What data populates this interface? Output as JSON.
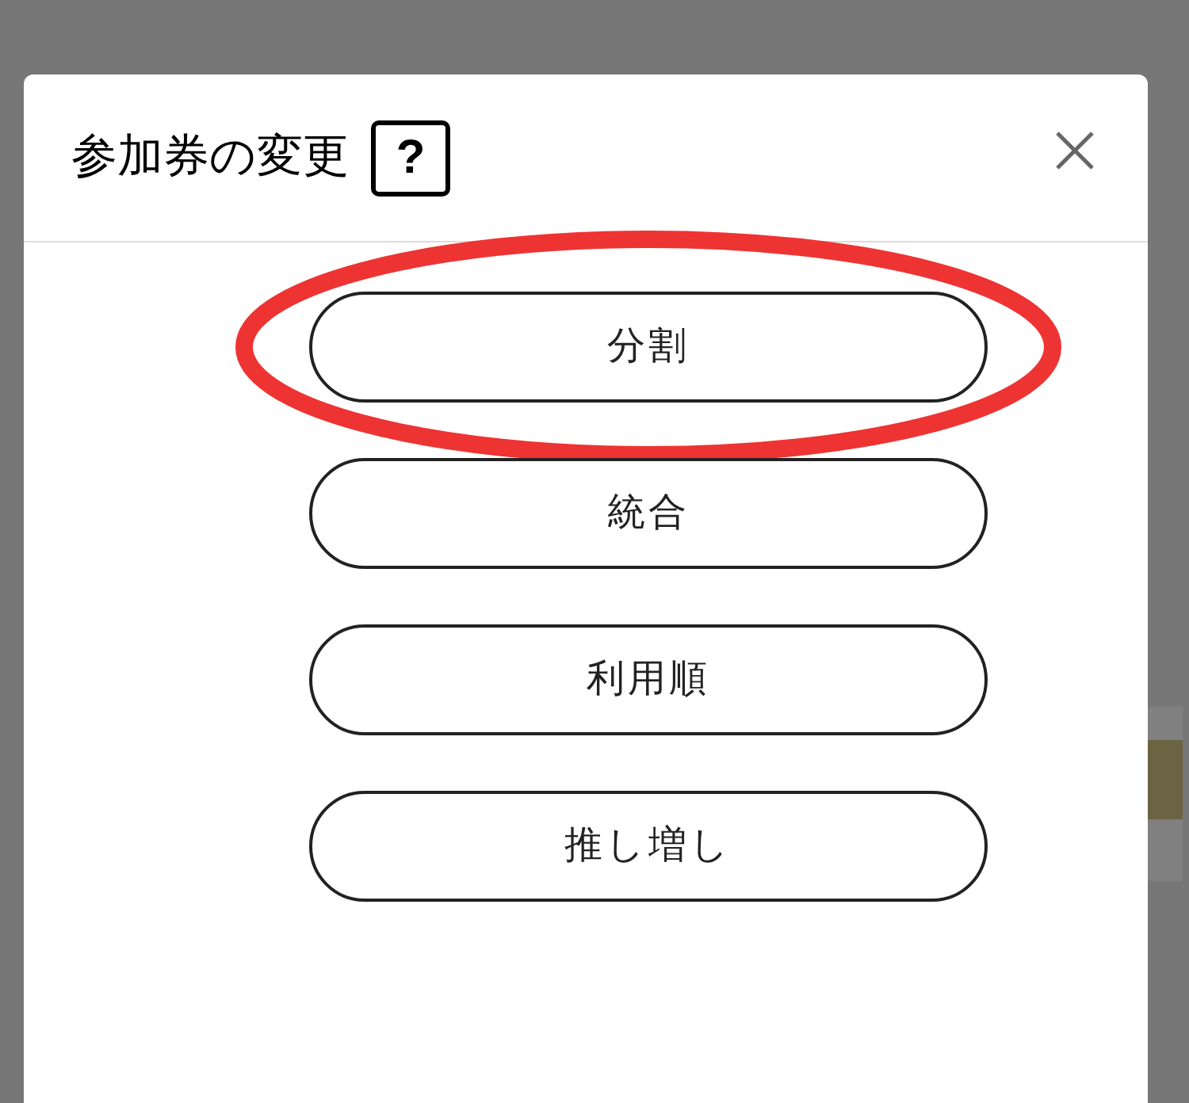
{
  "dialog": {
    "title": "参加券の変更",
    "help_label": "?"
  },
  "options": [
    {
      "label": "分割",
      "highlighted": true
    },
    {
      "label": "統合",
      "highlighted": false
    },
    {
      "label": "利用順",
      "highlighted": false
    },
    {
      "label": "推し増し",
      "highlighted": false
    }
  ]
}
